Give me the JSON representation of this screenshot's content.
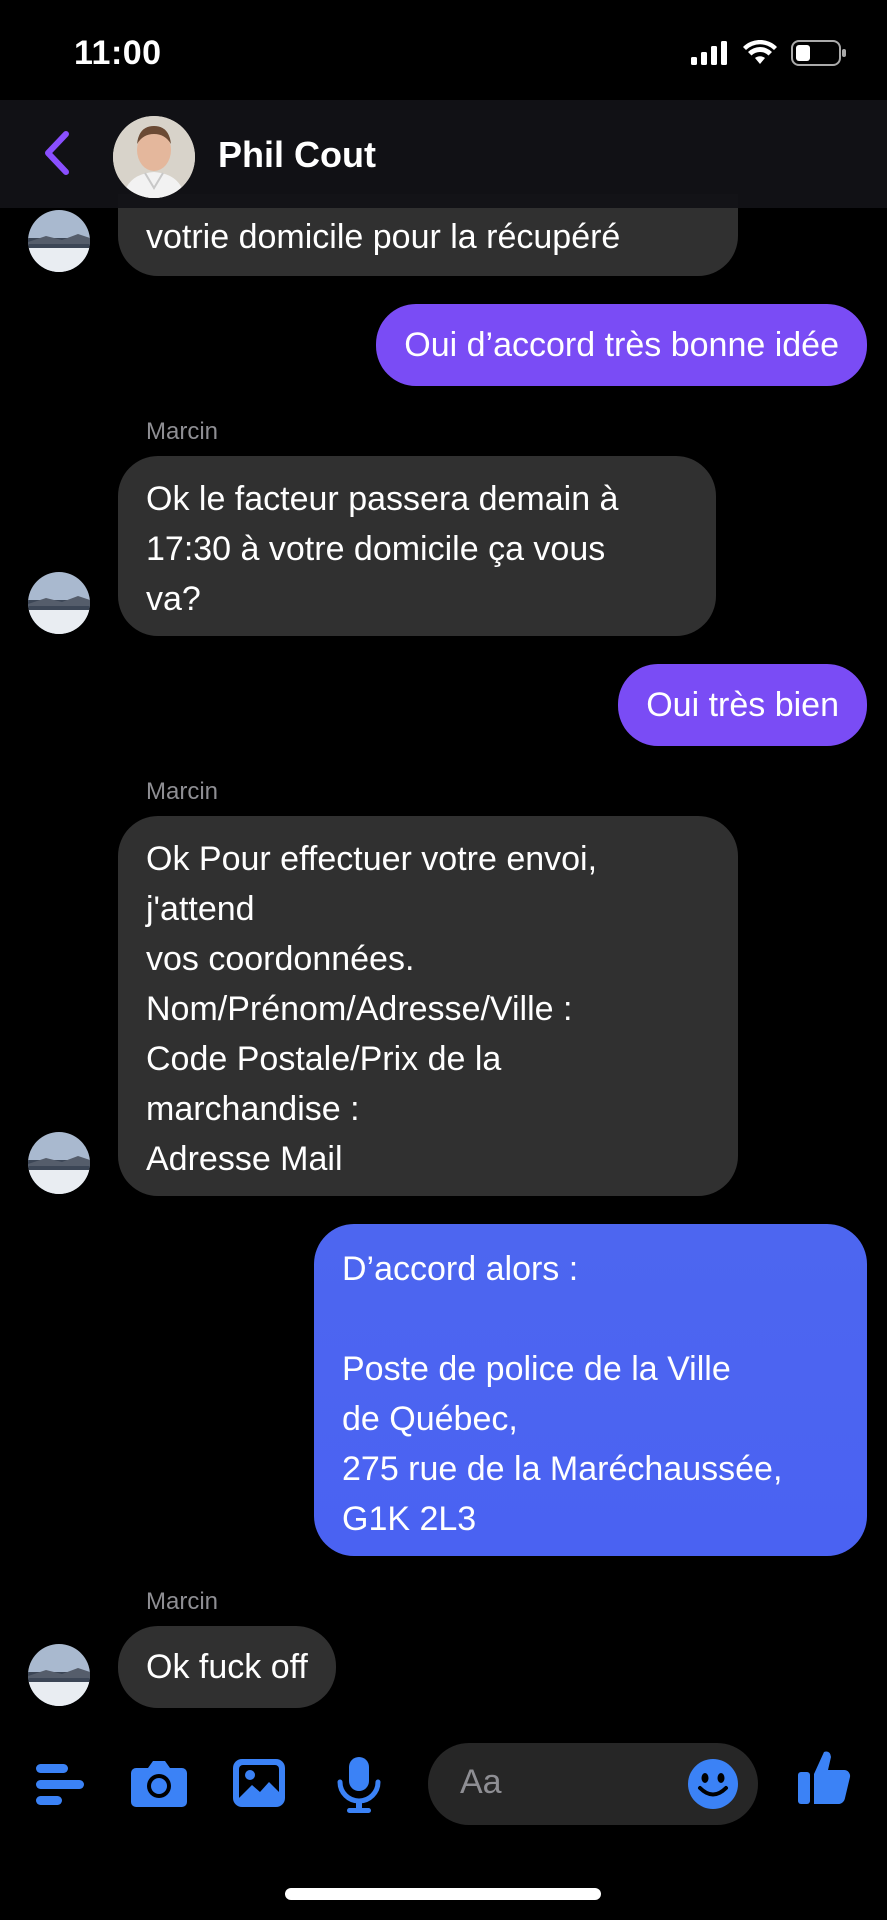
{
  "status_bar": {
    "time": "11:00"
  },
  "header": {
    "contact_name": "Phil Cout"
  },
  "messages": [
    {
      "from": "in",
      "text": "votrie domicile pour la récupéré"
    },
    {
      "from": "out",
      "text": "Oui d’accord très bonne idée"
    },
    {
      "from": "in",
      "sender": "Marcin",
      "text": "Ok le facteur passera demain à\n17:30 à votre domicile ça vous\nva?"
    },
    {
      "from": "out",
      "text": "Oui très bien"
    },
    {
      "from": "in",
      "sender": "Marcin",
      "text": "Ok Pour effectuer votre envoi,\nj'attend\nvos coordonnées.\nNom/Prénom/Adresse/Ville :\nCode Postale/Prix de la\nmarchandise :\nAdresse Mail"
    },
    {
      "from": "out",
      "text": "D’accord alors :\n\nPoste de police de la Ville\nde Québec,\n275 rue de la Maréchaussée,\nG1K 2L3"
    },
    {
      "from": "in",
      "sender": "Marcin",
      "text": "Ok fuck off"
    }
  ],
  "composer": {
    "placeholder": "Aa"
  },
  "colors": {
    "accent": "#7a4cf5",
    "blue": "#4a62f2",
    "incoming": "#303030",
    "icon_blue": "#3b82f6"
  },
  "icons": [
    "back-chevron-icon",
    "menu-icon",
    "camera-icon",
    "image-icon",
    "microphone-icon",
    "emoji-icon",
    "thumbs-up-icon",
    "signal-icon",
    "wifi-icon",
    "battery-icon"
  ]
}
